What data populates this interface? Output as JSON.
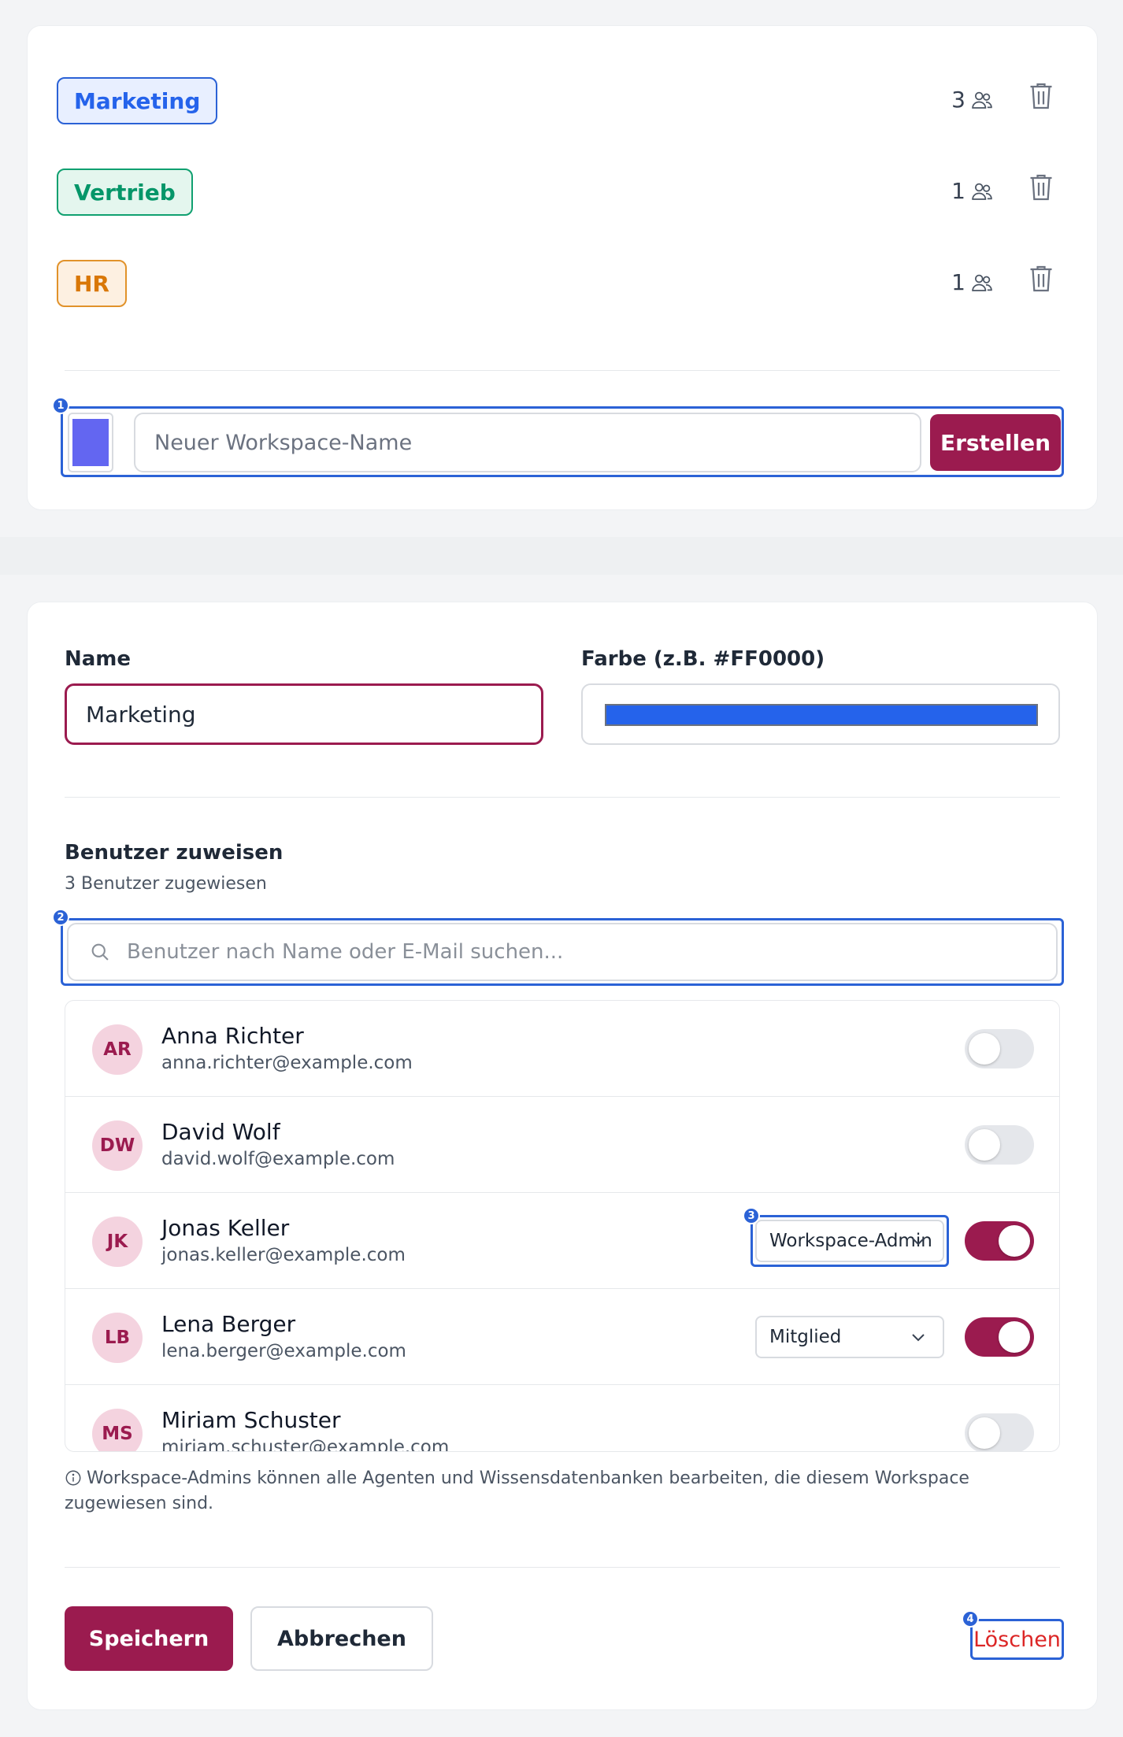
{
  "workspaces": [
    {
      "name": "Marketing",
      "count": "3",
      "color": "#2563eb",
      "bg": "#e8efff",
      "border": "#2b62d6"
    },
    {
      "name": "Vertrieb",
      "count": "1",
      "color": "#059669",
      "bg": "#e4f6ee",
      "border": "#10a070"
    },
    {
      "name": "HR",
      "count": "1",
      "color": "#d97706",
      "bg": "#fdf0e1",
      "border": "#e1922a"
    }
  ],
  "create": {
    "placeholder": "Neuer Workspace-Name",
    "button_label": "Erstellen",
    "swatch_color": "#6366f1",
    "badge": "1"
  },
  "form": {
    "name_label": "Name",
    "name_value": "Marketing",
    "color_label": "Farbe (z.B. #FF0000)",
    "color_value": "#2563eb"
  },
  "assign": {
    "title": "Benutzer zuweisen",
    "subtitle": "3 Benutzer zugewiesen",
    "search_placeholder": "Benutzer nach Name oder E-Mail suchen...",
    "search_badge": "2"
  },
  "users": [
    {
      "initials": "AR",
      "name": "Anna Richter",
      "email": "anna.richter@example.com",
      "assigned": false,
      "role": ""
    },
    {
      "initials": "DW",
      "name": "David Wolf",
      "email": "david.wolf@example.com",
      "assigned": false,
      "role": ""
    },
    {
      "initials": "JK",
      "name": "Jonas Keller",
      "email": "jonas.keller@example.com",
      "assigned": true,
      "role": "Workspace-Admin",
      "badge": "3"
    },
    {
      "initials": "LB",
      "name": "Lena Berger",
      "email": "lena.berger@example.com",
      "assigned": true,
      "role": "Mitglied"
    },
    {
      "initials": "MS",
      "name": "Miriam Schuster",
      "email": "miriam.schuster@example.com",
      "assigned": false,
      "role": ""
    }
  ],
  "info_text": "Workspace-Admins können alle Agenten und Wissensdatenbanken bearbeiten, die diesem Workspace zugewiesen sind.",
  "actions": {
    "save_label": "Speichern",
    "cancel_label": "Abbrechen",
    "delete_label": "Löschen",
    "delete_badge": "4"
  },
  "colors": {
    "accent": "#9b1b4f",
    "highlight": "#2b62d6",
    "danger": "#dc2626"
  }
}
